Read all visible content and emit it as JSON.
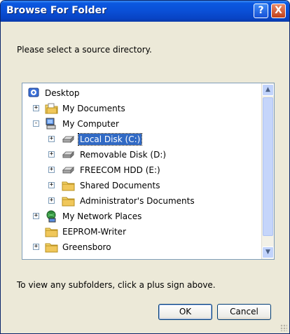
{
  "window": {
    "title": "Browse For Folder",
    "help_glyph": "?",
    "close_glyph": "X"
  },
  "prompt": "Please select a source directory.",
  "tree": {
    "selected": "Local Disk (C:)",
    "items": [
      {
        "label": "Desktop",
        "level": 0,
        "expander": "",
        "icon": "desktop-icon"
      },
      {
        "label": "My Documents",
        "level": 1,
        "expander": "+",
        "icon": "documents-folder-icon"
      },
      {
        "label": "My Computer",
        "level": 1,
        "expander": "-",
        "icon": "computer-icon"
      },
      {
        "label": "Local Disk (C:)",
        "level": 2,
        "expander": "+",
        "icon": "hard-drive-icon"
      },
      {
        "label": "Removable Disk (D:)",
        "level": 2,
        "expander": "+",
        "icon": "removable-drive-icon"
      },
      {
        "label": "FREECOM HDD (E:)",
        "level": 2,
        "expander": "+",
        "icon": "hard-drive-icon"
      },
      {
        "label": "Shared Documents",
        "level": 2,
        "expander": "+",
        "icon": "folder-icon"
      },
      {
        "label": "Administrator's Documents",
        "level": 2,
        "expander": "+",
        "icon": "folder-icon"
      },
      {
        "label": "My Network Places",
        "level": 1,
        "expander": "+",
        "icon": "network-places-icon"
      },
      {
        "label": "EEPROM-Writer",
        "level": 1,
        "expander": "",
        "icon": "folder-icon"
      },
      {
        "label": "Greensboro",
        "level": 1,
        "expander": "+",
        "icon": "folder-icon"
      }
    ]
  },
  "scrollbar": {
    "up_glyph": "▲",
    "down_glyph": "▼"
  },
  "hint": "To view any subfolders, click a plus sign above.",
  "buttons": {
    "ok": "OK",
    "cancel": "Cancel"
  },
  "colors": {
    "titlebar": "#0a4fd6",
    "selection": "#316ac5",
    "dialog": "#ece9d8"
  }
}
